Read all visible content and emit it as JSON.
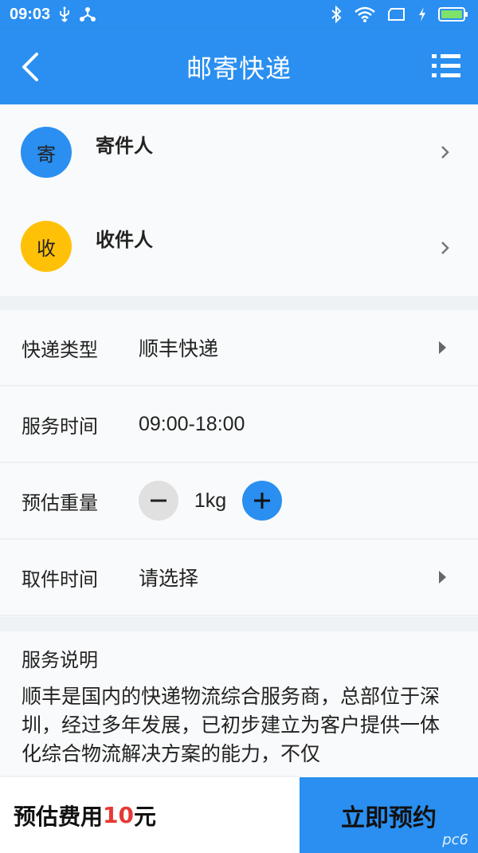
{
  "status_bar": {
    "time": "09:03"
  },
  "header": {
    "title": "邮寄快递"
  },
  "sender": {
    "badge": "寄",
    "label": "寄件人",
    "badge_color": "#2a8ff0"
  },
  "receiver": {
    "badge": "收",
    "label": "收件人",
    "badge_color": "#ffc107"
  },
  "form": {
    "courier_type": {
      "label": "快递类型",
      "value": "顺丰快递"
    },
    "service_time": {
      "label": "服务时间",
      "value": "09:00-18:00"
    },
    "weight": {
      "label": "预估重量",
      "value": "1kg"
    },
    "pickup_time": {
      "label": "取件时间",
      "value": "请选择"
    }
  },
  "description": {
    "title": "服务说明",
    "body": "顺丰是国内的快递物流综合服务商，总部位于深圳，经过多年发展，已初步建立为客户提供一体化综合物流解决方案的能力，不仅"
  },
  "footer": {
    "estimate_prefix": "预估费用",
    "estimate_amount": "10",
    "estimate_suffix": "元",
    "book_label": "立即预约",
    "watermark": "pc6"
  },
  "colors": {
    "primary": "#2a8ff0",
    "price": "#e53935"
  },
  "icons": {
    "back": "chevron-left-icon",
    "menu": "list-icon",
    "minus": "minus-icon",
    "plus": "plus-icon"
  }
}
